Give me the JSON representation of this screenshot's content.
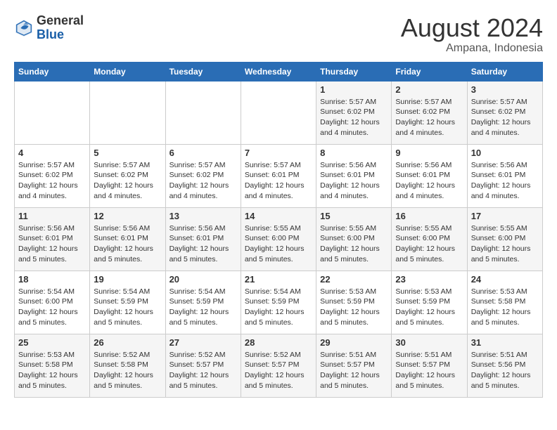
{
  "header": {
    "logo_line1": "General",
    "logo_line2": "Blue",
    "month_year": "August 2024",
    "location": "Ampana, Indonesia"
  },
  "weekdays": [
    "Sunday",
    "Monday",
    "Tuesday",
    "Wednesday",
    "Thursday",
    "Friday",
    "Saturday"
  ],
  "weeks": [
    [
      {
        "day": "",
        "content": ""
      },
      {
        "day": "",
        "content": ""
      },
      {
        "day": "",
        "content": ""
      },
      {
        "day": "",
        "content": ""
      },
      {
        "day": "1",
        "content": "Sunrise: 5:57 AM\nSunset: 6:02 PM\nDaylight: 12 hours\nand 4 minutes."
      },
      {
        "day": "2",
        "content": "Sunrise: 5:57 AM\nSunset: 6:02 PM\nDaylight: 12 hours\nand 4 minutes."
      },
      {
        "day": "3",
        "content": "Sunrise: 5:57 AM\nSunset: 6:02 PM\nDaylight: 12 hours\nand 4 minutes."
      }
    ],
    [
      {
        "day": "4",
        "content": "Sunrise: 5:57 AM\nSunset: 6:02 PM\nDaylight: 12 hours\nand 4 minutes."
      },
      {
        "day": "5",
        "content": "Sunrise: 5:57 AM\nSunset: 6:02 PM\nDaylight: 12 hours\nand 4 minutes."
      },
      {
        "day": "6",
        "content": "Sunrise: 5:57 AM\nSunset: 6:02 PM\nDaylight: 12 hours\nand 4 minutes."
      },
      {
        "day": "7",
        "content": "Sunrise: 5:57 AM\nSunset: 6:01 PM\nDaylight: 12 hours\nand 4 minutes."
      },
      {
        "day": "8",
        "content": "Sunrise: 5:56 AM\nSunset: 6:01 PM\nDaylight: 12 hours\nand 4 minutes."
      },
      {
        "day": "9",
        "content": "Sunrise: 5:56 AM\nSunset: 6:01 PM\nDaylight: 12 hours\nand 4 minutes."
      },
      {
        "day": "10",
        "content": "Sunrise: 5:56 AM\nSunset: 6:01 PM\nDaylight: 12 hours\nand 4 minutes."
      }
    ],
    [
      {
        "day": "11",
        "content": "Sunrise: 5:56 AM\nSunset: 6:01 PM\nDaylight: 12 hours\nand 5 minutes."
      },
      {
        "day": "12",
        "content": "Sunrise: 5:56 AM\nSunset: 6:01 PM\nDaylight: 12 hours\nand 5 minutes."
      },
      {
        "day": "13",
        "content": "Sunrise: 5:56 AM\nSunset: 6:01 PM\nDaylight: 12 hours\nand 5 minutes."
      },
      {
        "day": "14",
        "content": "Sunrise: 5:55 AM\nSunset: 6:00 PM\nDaylight: 12 hours\nand 5 minutes."
      },
      {
        "day": "15",
        "content": "Sunrise: 5:55 AM\nSunset: 6:00 PM\nDaylight: 12 hours\nand 5 minutes."
      },
      {
        "day": "16",
        "content": "Sunrise: 5:55 AM\nSunset: 6:00 PM\nDaylight: 12 hours\nand 5 minutes."
      },
      {
        "day": "17",
        "content": "Sunrise: 5:55 AM\nSunset: 6:00 PM\nDaylight: 12 hours\nand 5 minutes."
      }
    ],
    [
      {
        "day": "18",
        "content": "Sunrise: 5:54 AM\nSunset: 6:00 PM\nDaylight: 12 hours\nand 5 minutes."
      },
      {
        "day": "19",
        "content": "Sunrise: 5:54 AM\nSunset: 5:59 PM\nDaylight: 12 hours\nand 5 minutes."
      },
      {
        "day": "20",
        "content": "Sunrise: 5:54 AM\nSunset: 5:59 PM\nDaylight: 12 hours\nand 5 minutes."
      },
      {
        "day": "21",
        "content": "Sunrise: 5:54 AM\nSunset: 5:59 PM\nDaylight: 12 hours\nand 5 minutes."
      },
      {
        "day": "22",
        "content": "Sunrise: 5:53 AM\nSunset: 5:59 PM\nDaylight: 12 hours\nand 5 minutes."
      },
      {
        "day": "23",
        "content": "Sunrise: 5:53 AM\nSunset: 5:59 PM\nDaylight: 12 hours\nand 5 minutes."
      },
      {
        "day": "24",
        "content": "Sunrise: 5:53 AM\nSunset: 5:58 PM\nDaylight: 12 hours\nand 5 minutes."
      }
    ],
    [
      {
        "day": "25",
        "content": "Sunrise: 5:53 AM\nSunset: 5:58 PM\nDaylight: 12 hours\nand 5 minutes."
      },
      {
        "day": "26",
        "content": "Sunrise: 5:52 AM\nSunset: 5:58 PM\nDaylight: 12 hours\nand 5 minutes."
      },
      {
        "day": "27",
        "content": "Sunrise: 5:52 AM\nSunset: 5:57 PM\nDaylight: 12 hours\nand 5 minutes."
      },
      {
        "day": "28",
        "content": "Sunrise: 5:52 AM\nSunset: 5:57 PM\nDaylight: 12 hours\nand 5 minutes."
      },
      {
        "day": "29",
        "content": "Sunrise: 5:51 AM\nSunset: 5:57 PM\nDaylight: 12 hours\nand 5 minutes."
      },
      {
        "day": "30",
        "content": "Sunrise: 5:51 AM\nSunset: 5:57 PM\nDaylight: 12 hours\nand 5 minutes."
      },
      {
        "day": "31",
        "content": "Sunrise: 5:51 AM\nSunset: 5:56 PM\nDaylight: 12 hours\nand 5 minutes."
      }
    ]
  ]
}
